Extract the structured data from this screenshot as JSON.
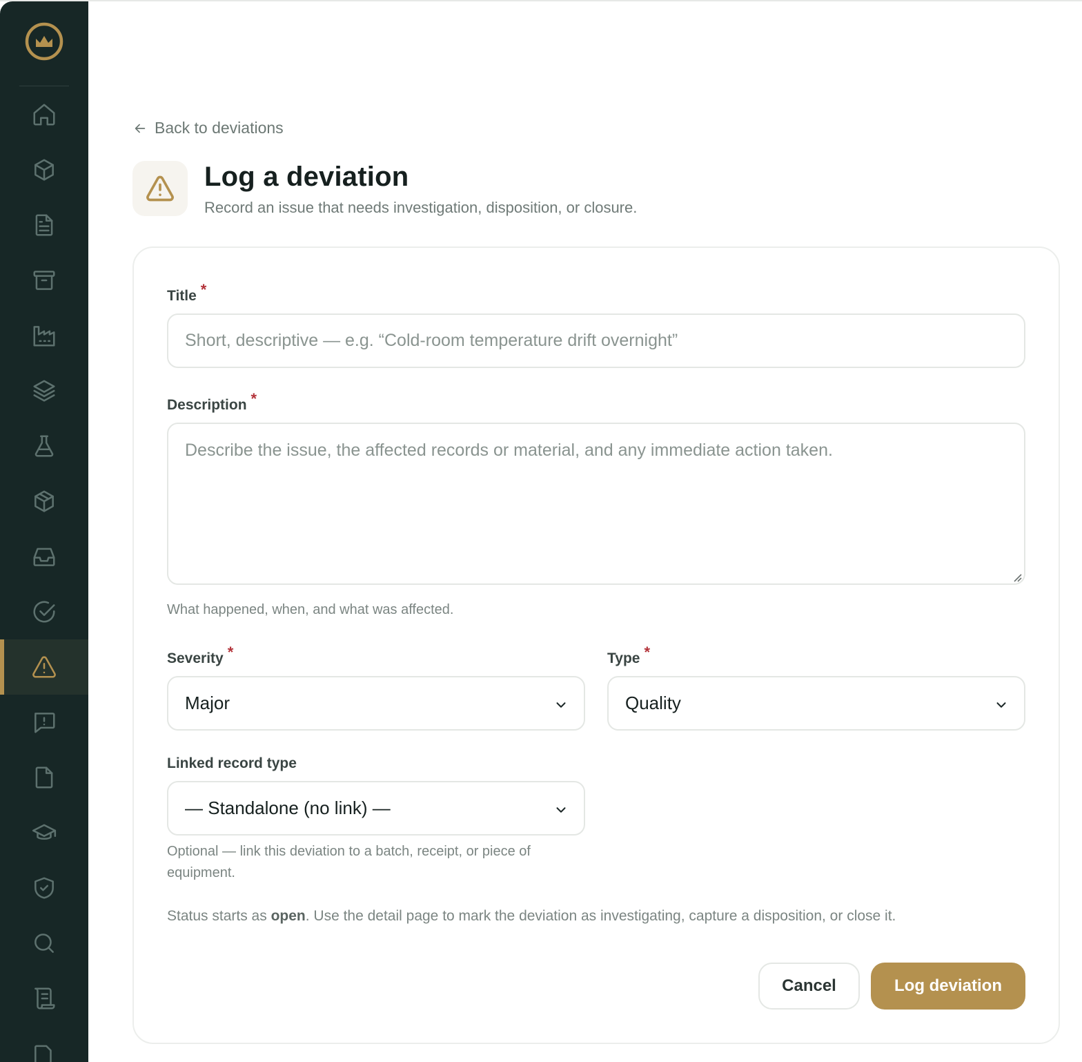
{
  "nav": {
    "items": [
      {
        "icon": "home-icon",
        "active": false
      },
      {
        "icon": "box-icon",
        "active": false
      },
      {
        "icon": "document-icon",
        "active": false
      },
      {
        "icon": "archive-icon",
        "active": false
      },
      {
        "icon": "factory-icon",
        "active": false
      },
      {
        "icon": "layers-icon",
        "active": false
      },
      {
        "icon": "flask-icon",
        "active": false
      },
      {
        "icon": "package-icon",
        "active": false
      },
      {
        "icon": "inbox-icon",
        "active": false
      },
      {
        "icon": "check-circle-icon",
        "active": false
      },
      {
        "icon": "warning-icon",
        "active": true
      },
      {
        "icon": "message-alert-icon",
        "active": false
      },
      {
        "icon": "file-icon",
        "active": false
      },
      {
        "icon": "graduation-cap-icon",
        "active": false
      },
      {
        "icon": "shield-check-icon",
        "active": false
      },
      {
        "icon": "search-icon",
        "active": false
      },
      {
        "icon": "scroll-icon",
        "active": false
      },
      {
        "icon": "more-icon",
        "active": false
      }
    ]
  },
  "header": {
    "back_label": "Back to deviations",
    "title": "Log a deviation",
    "subtitle": "Record an issue that needs investigation, disposition, or closure."
  },
  "form": {
    "title_label": "Title",
    "title_placeholder": "Short, descriptive — e.g. “Cold-room temperature drift overnight”",
    "title_value": "",
    "description_label": "Description",
    "description_placeholder": "Describe the issue, the affected records or material, and any immediate action taken.",
    "description_value": "",
    "description_hint": "What happened, when, and what was affected.",
    "severity_label": "Severity",
    "severity_value": "Major",
    "type_label": "Type",
    "type_value": "Quality",
    "linked_label": "Linked record type",
    "linked_value": "— Standalone (no link) —",
    "linked_hint": "Optional — link this deviation to a batch, receipt, or piece of equipment.",
    "required_mark": "*",
    "status_prefix": "Status starts as ",
    "status_word": "open",
    "status_suffix": ". Use the detail page to mark the deviation as investigating, capture a disposition, or close it."
  },
  "actions": {
    "cancel_label": "Cancel",
    "submit_label": "Log deviation"
  },
  "colors": {
    "sidebar_bg": "#172726",
    "accent": "#b4914f",
    "required": "#b3333a"
  }
}
